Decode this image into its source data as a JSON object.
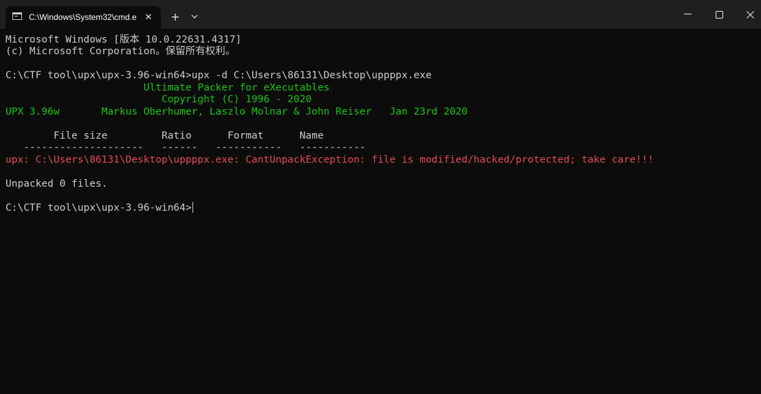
{
  "window": {
    "tab_title": "C:\\Windows\\System32\\cmd.e",
    "tab_icon": "cmd-icon",
    "close_tab_glyph": "✕",
    "new_tab_glyph": "+",
    "caption": {
      "minimize": "—",
      "maximize": "☐",
      "close": "✕"
    }
  },
  "colors": {
    "background": "#0c0c0c",
    "titlebar": "#1f1f1f",
    "text_default": "#cccccc",
    "text_green": "#16c60c",
    "text_red": "#e74856"
  },
  "terminal": {
    "lines": [
      "Microsoft Windows [版本 10.0.22631.4317]",
      "(c) Microsoft Corporation。保留所有权利。",
      "",
      "C:\\CTF tool\\upx\\upx-3.96-win64>upx -d C:\\Users\\86131\\Desktop\\uppppx.exe",
      "                       Ultimate Packer for eXecutables",
      "                          Copyright (C) 1996 - 2020",
      "UPX 3.96w       Markus Oberhumer, Laszlo Molnar & John Reiser   Jan 23rd 2020",
      "",
      "        File size         Ratio      Format      Name",
      "   --------------------   ------   -----------   -----------",
      "upx: C:\\Users\\86131\\Desktop\\uppppx.exe: CantUnpackException: file is modified/hacked/protected; take care!!!",
      "",
      "Unpacked 0 files.",
      "",
      "C:\\CTF tool\\upx\\upx-3.96-win64>"
    ]
  }
}
